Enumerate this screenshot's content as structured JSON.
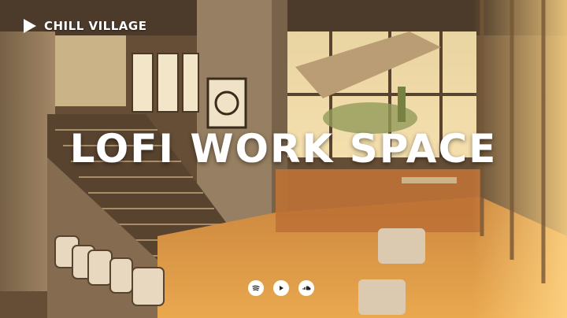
{
  "channel": {
    "name": "CHILL VILLAGE",
    "play_icon": "play-icon"
  },
  "title": "LOFI WORK SPACE",
  "socials": [
    {
      "icon": "spotify-icon"
    },
    {
      "icon": "youtube-icon"
    },
    {
      "icon": "soundcloud-icon"
    }
  ]
}
